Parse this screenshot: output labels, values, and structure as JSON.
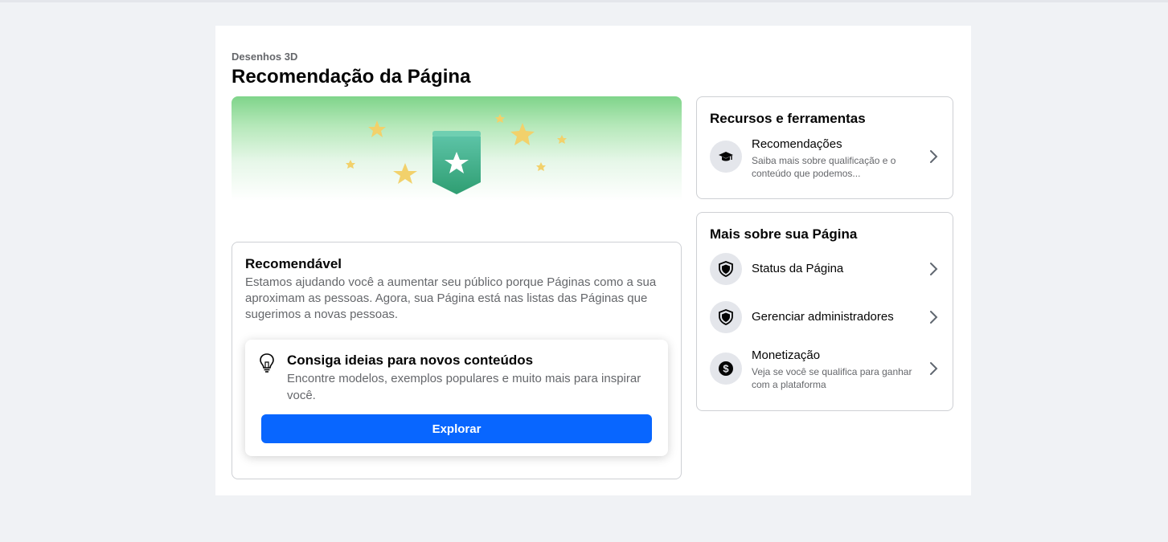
{
  "header": {
    "page_name": "Desenhos 3D",
    "title": "Recomendação da Página"
  },
  "recommendation": {
    "title": "Recomendável",
    "description": "Estamos ajudando você a aumentar seu público porque Páginas como a sua aproximam as pessoas. Agora, sua Página está nas listas das Páginas que sugerimos a novas pessoas."
  },
  "ideas": {
    "icon": "lightbulb-icon",
    "title": "Consiga ideias para novos conteúdos",
    "description": "Encontre modelos, exemplos populares e muito mais para inspirar você.",
    "button_label": "Explorar"
  },
  "resources": {
    "title": "Recursos e ferramentas",
    "items": [
      {
        "icon": "graduation-cap-icon",
        "label": "Recomendações",
        "sub": "Saiba mais sobre qualificação e o conteúdo que podemos..."
      }
    ]
  },
  "more": {
    "title": "Mais sobre sua Página",
    "items": [
      {
        "icon": "shield-icon",
        "label": "Status da Página"
      },
      {
        "icon": "shield-icon",
        "label": "Gerenciar administradores"
      },
      {
        "icon": "dollar-icon",
        "label": "Monetização",
        "sub": "Veja se você se qualifica para ganhar com a plataforma"
      }
    ]
  },
  "colors": {
    "accent": "#0866ff",
    "badge_green": "#3fae8e",
    "star_yellow": "#f2d16b",
    "background": "#f0f2f5"
  }
}
